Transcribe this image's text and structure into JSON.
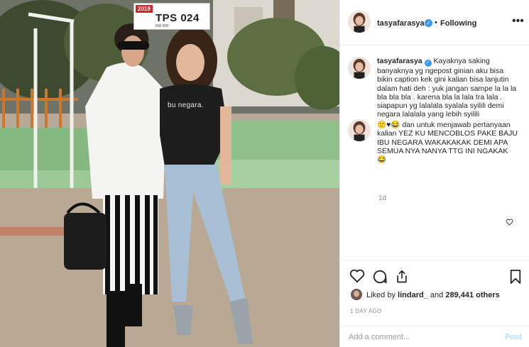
{
  "post": {
    "author": "tasyafarasya",
    "follow_status": "Following",
    "separator": "•",
    "more_icon": "more-horizontal-icon",
    "caption_text": "Kayaknya saking banyaknya yg ngepost ginian aku bisa bikin caption kek gini kalian bisa lanjutin dalam hati deh : yuk jangan sampe la la la bla bla bla . karena bla la lala tra lala . siapapun yg lalalala syalala syilili demi negara lalalala yang lebih syilili",
    "caption_emoji": "🙂♥😂",
    "caption_tail": "dan untuk menjawab pertanyaan kalian YEZ KU MENCOBLOS PAKE BAJU IBU NEGARA WAKAKAKAK DEMI APA SEMUA NYA NANYA TTG INI NGAKAK",
    "caption_end_emoji": "😂",
    "comment_age": "1d",
    "liked_by_prefix": "Liked by",
    "liked_by_user": "lindard_",
    "liked_by_and": "and",
    "likes_others": "289,441 others",
    "posted_ago": "1 DAY AGO",
    "comment_placeholder": "Add a comment...",
    "post_button": "Post"
  },
  "photo": {
    "sign_year": "2019",
    "sign_text": "TPS 024",
    "sign_sub": "RW 008",
    "shirt_text": "bu negara."
  },
  "colors": {
    "verified": "#3897f0",
    "post_button_disabled": "#b2dffc",
    "muted_text": "#8e8e8e"
  }
}
